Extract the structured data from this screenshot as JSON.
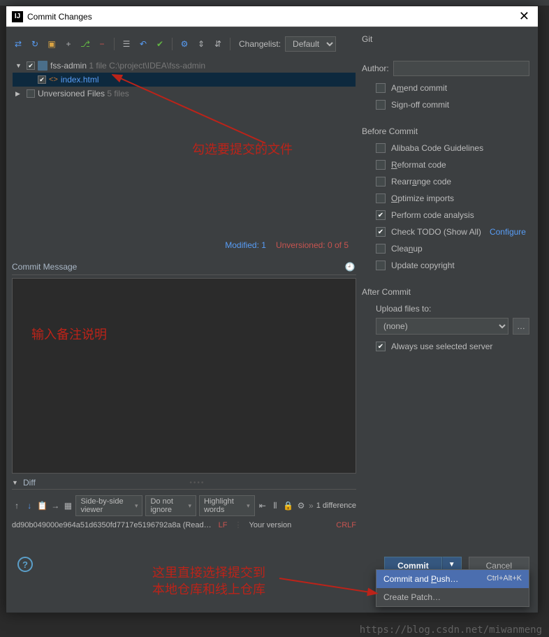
{
  "title": "Commit Changes",
  "changelist": {
    "label": "Changelist:",
    "value": "Default"
  },
  "tree": {
    "root": {
      "name": "fss-admin",
      "count": "1 file",
      "path": "C:\\project\\IDEA\\fss-admin"
    },
    "file": {
      "name": "index.html"
    },
    "unversioned": {
      "label": "Unversioned Files",
      "count": "5 files"
    }
  },
  "file_status": {
    "modified": "Modified: 1",
    "unversioned": "Unversioned: 0 of 5"
  },
  "commit_msg_label": "Commit Message",
  "git": {
    "section": "Git",
    "author_label": "Author:",
    "amend": "Amend commit",
    "signoff": "Sign-off commit"
  },
  "before": {
    "section": "Before Commit",
    "alibaba": "Alibaba Code Guidelines",
    "reformat": "Reformat code",
    "rearrange": "Rearrange code",
    "optimize": "Optimize imports",
    "perform": "Perform code analysis",
    "todo": "Check TODO (Show All)",
    "configure": "Configure",
    "cleanup": "Cleanup",
    "copyright": "Update copyright"
  },
  "after": {
    "section": "After Commit",
    "upload_label": "Upload files to:",
    "upload_value": "(none)",
    "always": "Always use selected server"
  },
  "diff": {
    "label": "Diff",
    "viewer": "Side-by-side viewer",
    "ignore": "Do not ignore",
    "highlight": "Highlight words",
    "count": "1 difference",
    "rev_left": "dd90b049000e964a51d6350fd7717e5196792a8a (Read…",
    "lf": "LF",
    "rev_right": "Your version",
    "crlf": "CRLF"
  },
  "buttons": {
    "commit": "Commit",
    "cancel": "Cancel"
  },
  "dropdown": {
    "commit_push": "Commit and Push…",
    "shortcut": "Ctrl+Alt+K",
    "create_patch": "Create Patch…"
  },
  "annotations": {
    "a1": "勾选要提交的文件",
    "a2": "输入备注说明",
    "a3_l1": "这里直接选择提交到",
    "a3_l2": "本地仓库和线上仓库"
  },
  "watermark": "https://blog.csdn.net/miwanmeng"
}
